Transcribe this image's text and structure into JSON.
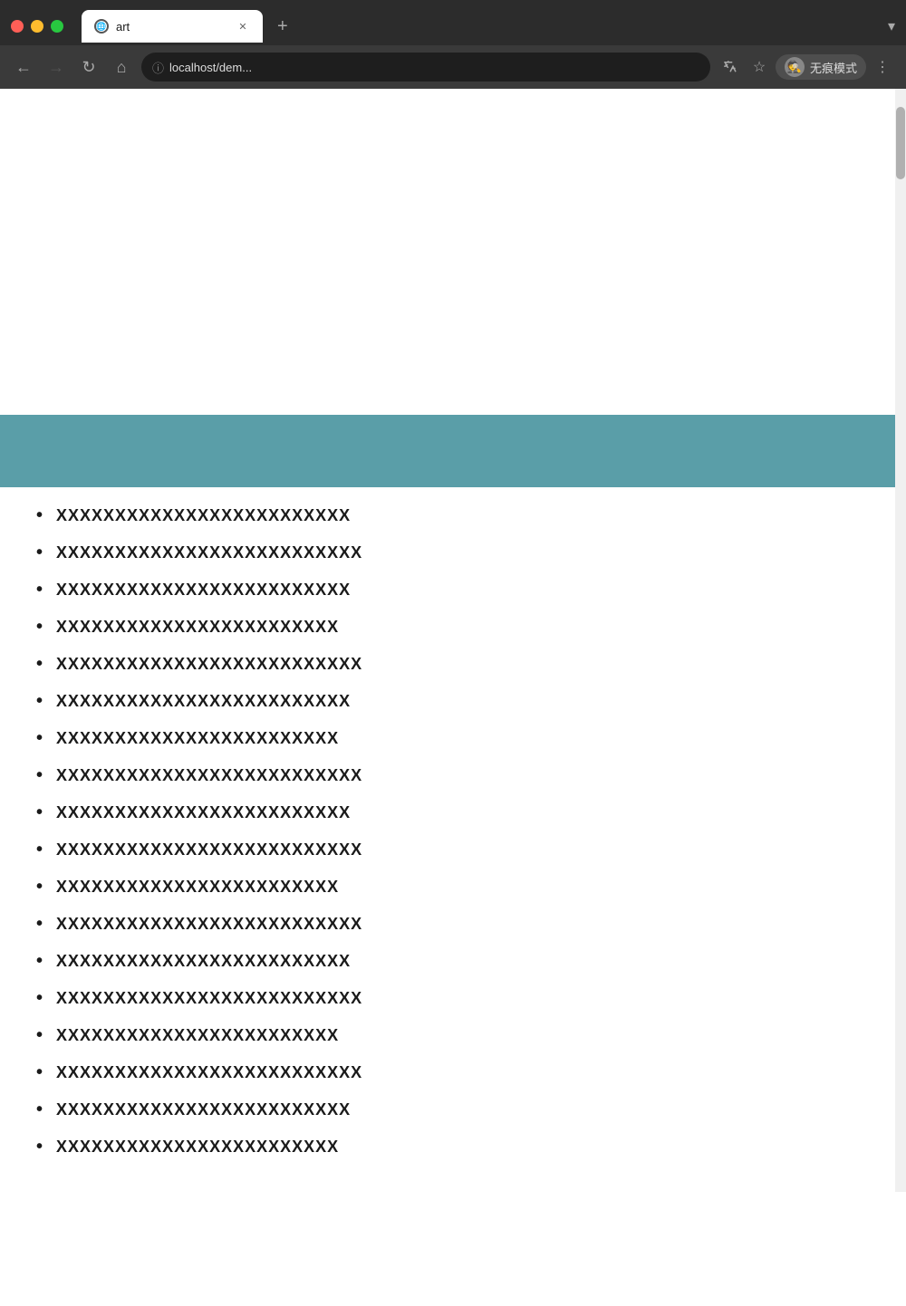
{
  "browser": {
    "tab_title": "art",
    "url": "localhost/dem...",
    "incognito_label": "无痕模式",
    "new_tab_symbol": "+",
    "menu_symbol": "⌄"
  },
  "page": {
    "teal_color": "#5a9ea8",
    "list_items": [
      "XXXXXXXXXXXXXXXXXXXXXXXXX",
      "XXXXXXXXXXXXXXXXXXXXXXXXXX",
      "XXXXXXXXXXXXXXXXXXXXXXXXX",
      "XXXXXXXXXXXXXXXXXXXXXXXX",
      "XXXXXXXXXXXXXXXXXXXXXXXXXX",
      "XXXXXXXXXXXXXXXXXXXXXXXXX",
      "XXXXXXXXXXXXXXXXXXXXXXXX",
      "XXXXXXXXXXXXXXXXXXXXXXXXXX",
      "XXXXXXXXXXXXXXXXXXXXXXXXX",
      "XXXXXXXXXXXXXXXXXXXXXXXXXX",
      "XXXXXXXXXXXXXXXXXXXXXXXX",
      "XXXXXXXXXXXXXXXXXXXXXXXXXX",
      "XXXXXXXXXXXXXXXXXXXXXXXXX",
      "XXXXXXXXXXXXXXXXXXXXXXXXXX",
      "XXXXXXXXXXXXXXXXXXXXXXXX",
      "XXXXXXXXXXXXXXXXXXXXXXXXXX",
      "XXXXXXXXXXXXXXXXXXXXXXXXX",
      "XXXXXXXXXXXXXXXXXXXXXXXX"
    ]
  }
}
